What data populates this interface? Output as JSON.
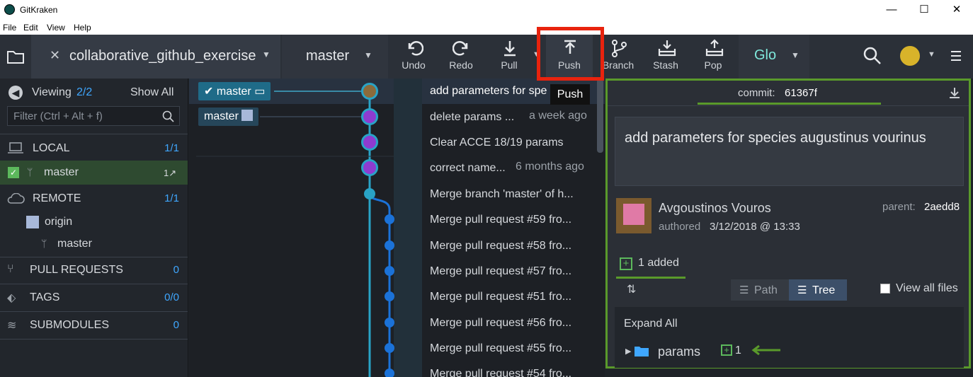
{
  "window": {
    "title": "GitKraken",
    "min": "—",
    "max": "☐",
    "close": "✕"
  },
  "menu": [
    "File",
    "Edit",
    "View",
    "Help"
  ],
  "toolbar": {
    "repo_name": "collaborative_github_exercise",
    "branch_name": "master",
    "buttons": [
      {
        "label": "Undo",
        "icon": "undo-icon"
      },
      {
        "label": "Redo",
        "icon": "redo-icon"
      },
      {
        "label": "Pull",
        "icon": "pull-icon"
      },
      {
        "label": "Push",
        "icon": "push-icon"
      },
      {
        "label": "Branch",
        "icon": "branch-icon"
      },
      {
        "label": "Stash",
        "icon": "stash-icon"
      },
      {
        "label": "Pop",
        "icon": "pop-icon"
      }
    ],
    "glo_label": "Glo",
    "tooltip": "Push"
  },
  "left": {
    "viewing_label": "Viewing",
    "viewing_count": "2/2",
    "show_all": "Show All",
    "filter_placeholder": "Filter (Ctrl + Alt + f)",
    "local": {
      "label": "LOCAL",
      "count": "1/1"
    },
    "local_branch": {
      "label": "master",
      "status": "1↗"
    },
    "remote": {
      "label": "REMOTE",
      "count": "1/1"
    },
    "origin": "origin",
    "origin_branch": "master",
    "pull_requests": {
      "label": "PULL REQUESTS",
      "count": "0"
    },
    "tags": {
      "label": "TAGS",
      "count": "0/0"
    },
    "submodules": {
      "label": "SUBMODULES",
      "count": "0"
    }
  },
  "graph": {
    "badges": [
      {
        "label": "master",
        "kind": "local"
      },
      {
        "label": "master",
        "kind": "remote"
      }
    ],
    "commits": [
      {
        "message": "add parameters for spe",
        "time": ""
      },
      {
        "message": "delete params ...",
        "time": "a week ago"
      },
      {
        "message": "Clear ACCE 18/19 params",
        "time": ""
      },
      {
        "message": "correct name...",
        "time": "6 months ago"
      },
      {
        "message": "Merge branch 'master' of h...",
        "time": ""
      },
      {
        "message": "Merge pull request #59 fro...",
        "time": ""
      },
      {
        "message": "Merge pull request #58 fro...",
        "time": ""
      },
      {
        "message": "Merge pull request #57 fro...",
        "time": ""
      },
      {
        "message": "Merge pull request #51 fro...",
        "time": ""
      },
      {
        "message": "Merge pull request #56 fro...",
        "time": ""
      },
      {
        "message": "Merge pull request #55 fro...",
        "time": ""
      },
      {
        "message": "Merge pull request #54 fro...",
        "time": ""
      }
    ]
  },
  "detail": {
    "commit_label": "commit:",
    "commit_sha": "61367f",
    "message": "add parameters for species augustinus vourinus",
    "author": "Avgoustinos Vouros",
    "authored_label": "authored",
    "authored_date": "3/12/2018 @ 13:33",
    "parent_label": "parent:",
    "parent_sha": "2aedd8",
    "added_label": "1 added",
    "path_label": "Path",
    "tree_label": "Tree",
    "view_all_label": "View all files",
    "expand_all": "Expand All",
    "folder": "params",
    "folder_count": "1"
  },
  "colors": {
    "accent": "#3fa7ff",
    "highlight_box": "#e8230e",
    "panel_border": "#5a9a2b",
    "added": "#5cb85c"
  }
}
